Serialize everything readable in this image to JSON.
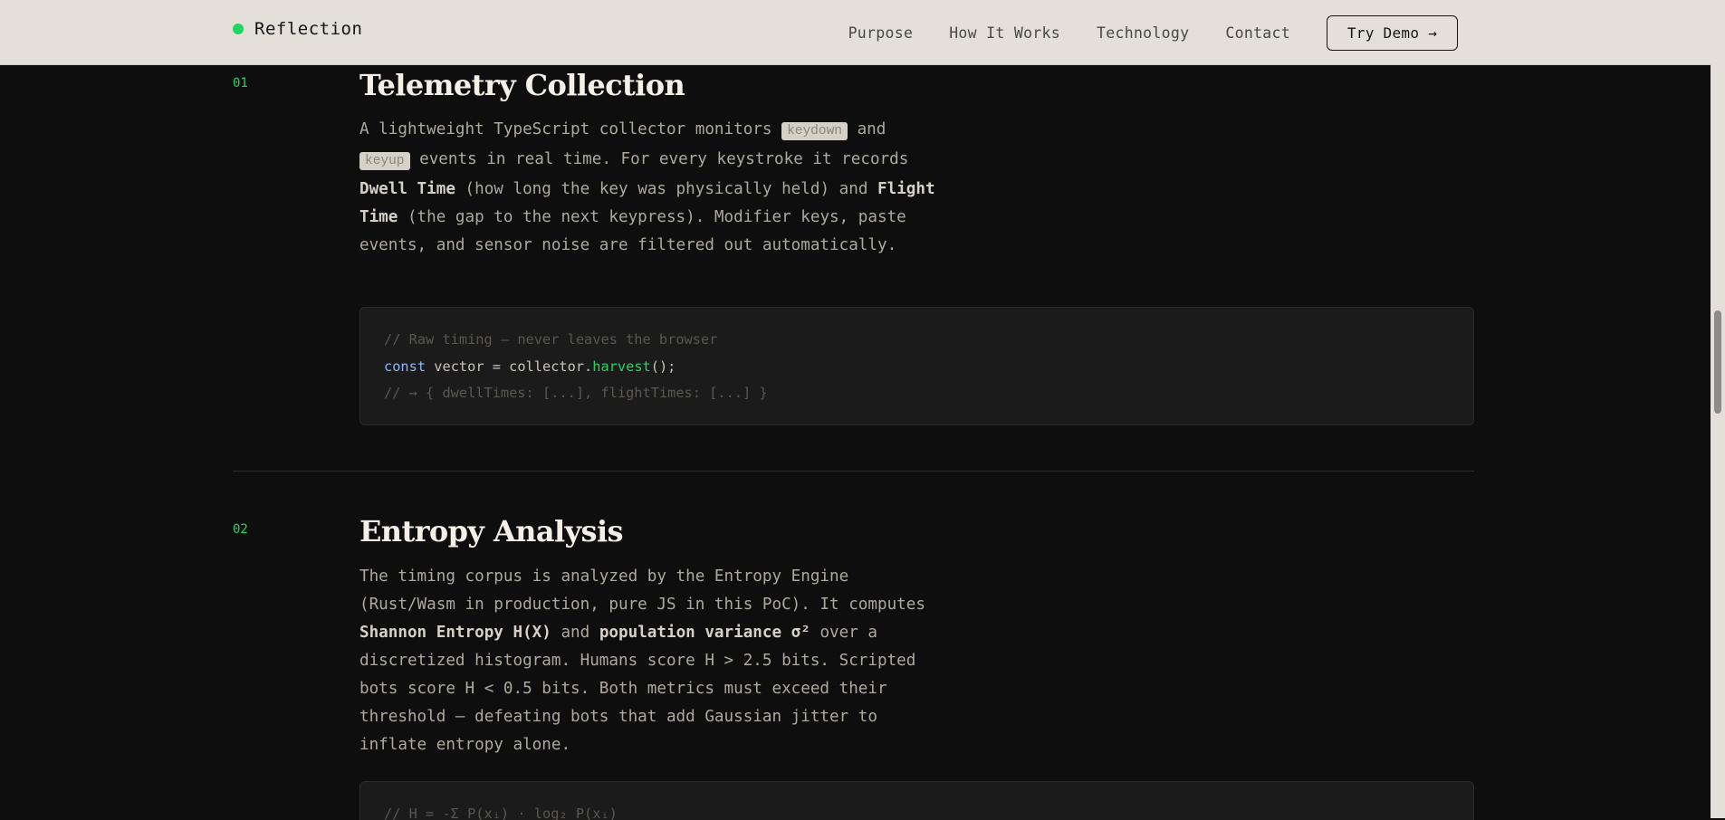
{
  "nav": {
    "brand": "Reflection",
    "links": [
      "Purpose",
      "How It Works",
      "Technology",
      "Contact"
    ],
    "cta": "Try Demo →"
  },
  "steps": [
    {
      "number": "01",
      "title": "Telemetry Collection",
      "desc": {
        "p1": "A lightweight TypeScript collector monitors ",
        "chip1": "keydown",
        "p2": " and ",
        "chip2": "keyup",
        "p3": " events in real time. For every keystroke it records ",
        "b1": "Dwell Time",
        "p4": " (how long the key was physically held) and ",
        "b2": "Flight Time",
        "p5": " (the gap to the next keypress). Modifier keys, paste events, and sensor noise are filtered out automatically."
      },
      "code": {
        "l1": "// Raw timing — never leaves the browser",
        "l2_kw": "const",
        "l2_a": " vector = collector.",
        "l2_fn": "harvest",
        "l2_b": "();",
        "l3": "// → { dwellTimes: [...], flightTimes: [...] }"
      }
    },
    {
      "number": "02",
      "title": "Entropy Analysis",
      "desc": {
        "p1": "The timing corpus is analyzed by the Entropy Engine (Rust/Wasm in production, pure JS in this PoC). It computes ",
        "b1": "Shannon Entropy H(X)",
        "p2": " and ",
        "b2": "population variance σ²",
        "p3": " over a discretized histogram. Humans score H > 2.5 bits. Scripted bots score H < 0.5 bits. Both metrics must exceed their threshold — defeating bots that add Gaussian jitter to inflate entropy alone."
      },
      "code": {
        "l1": "// H = -Σ P(xᵢ) · log₂ P(xᵢ)"
      }
    }
  ]
}
